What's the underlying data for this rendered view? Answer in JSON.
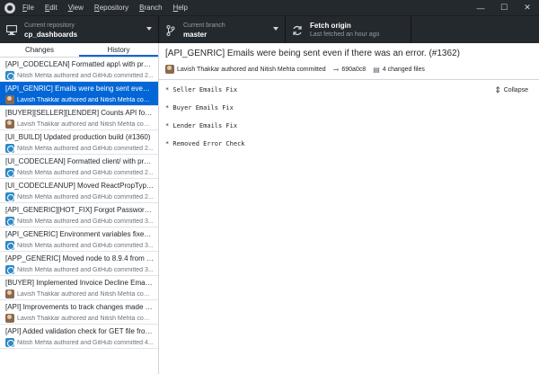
{
  "menu": {
    "file": "File",
    "edit": "Edit",
    "view": "View",
    "repository": "Repository",
    "branch": "Branch",
    "help": "Help"
  },
  "window_controls": {
    "minimize": "—",
    "maximize": "☐",
    "close": "✕"
  },
  "toolbar": {
    "repo_label": "Current repository",
    "repo_value": "cp_dashboards",
    "branch_label": "Current branch",
    "branch_value": "master",
    "fetch_title": "Fetch origin",
    "fetch_subtitle": "Last fetched an hour ago"
  },
  "sidebar": {
    "tabs": [
      {
        "label": "Changes",
        "selected": false
      },
      {
        "label": "History",
        "selected": true
      }
    ],
    "commits": [
      {
        "title": "[API_CODECLEAN] Formatted app\\ with prettie...",
        "author": "Nitish Mehta authored and GitHub committed 2...",
        "avatar": "bot",
        "selected": false
      },
      {
        "title": "[API_GENRIC] Emails were being sent even if th...",
        "author": "Lavish Thakkar authored and Nitish Mehta comm...",
        "avatar": "person",
        "selected": true
      },
      {
        "title": "[BUYER][SELLER][LENDER] Counts API for Credi...",
        "author": "Lavish Thakkar authored and Nitish Mehta comm...",
        "avatar": "person",
        "selected": false
      },
      {
        "title": "[UI_BUILD] Updated production build (#1360)",
        "author": "Nitish Mehta authored and GitHub committed 2...",
        "avatar": "bot",
        "selected": false
      },
      {
        "title": "[UI_CODECLEAN] Formatted client/ with prettie...",
        "author": "Nitish Mehta authored and GitHub committed 2...",
        "avatar": "bot",
        "selected": false
      },
      {
        "title": "[UI_CODECLEANUP] Moved ReactPropTypes to ...",
        "author": "Nitish Mehta authored and GitHub committed 2...",
        "avatar": "bot",
        "selected": false
      },
      {
        "title": "[API_GENERIC][HOT_FIX] Forgot Password ema...",
        "author": "Nitish Mehta authored and GitHub committed 3...",
        "avatar": "bot",
        "selected": false
      },
      {
        "title": "[API_GENERIC] Environment variables fixed for ...",
        "author": "Nitish Mehta authored and GitHub committed 3...",
        "avatar": "bot",
        "selected": false
      },
      {
        "title": "[APP_GENERIC] Moved node to 8.9.4 from 6.11....",
        "author": "Nitish Mehta authored and GitHub committed 3...",
        "avatar": "bot",
        "selected": false
      },
      {
        "title": "[BUYER] Implemented Invoice Decline Email an...",
        "author": "Lavish Thakkar authored and Nitish Mehta comm...",
        "avatar": "person",
        "selected": false
      },
      {
        "title": "[API] Improvements to track changes made usi...",
        "author": "Lavish Thakkar authored and Nitish Mehta comm...",
        "avatar": "person",
        "selected": false
      },
      {
        "title": "[API] Added validation check for GET file from ...",
        "author": "Nitish Mehta authored and GitHub committed 4...",
        "avatar": "bot",
        "selected": false
      }
    ]
  },
  "commit": {
    "summary": "[API_GENRIC] Emails were being sent even if there was an error. (#1362)",
    "authors": "Lavish Thakkar authored and Nitish Mehta committed",
    "sha": "690a0c8",
    "files": "4 changed files",
    "collapse_label": "Collapse",
    "description": [
      "* Seller Emails Fix",
      "* Buyer Emails Fix",
      "* Lender Emails Fix",
      "* Removed Error Check"
    ]
  },
  "colors": {
    "dark_bar": "#24292e",
    "accent": "#0366d6"
  },
  "icons": {
    "app": "github-logo-icon",
    "repo": "computer-icon",
    "branch": "branch-icon",
    "fetch": "sync-icon",
    "sha": "commit-icon",
    "files": "file-icon",
    "collapse": "collapse-icon"
  }
}
